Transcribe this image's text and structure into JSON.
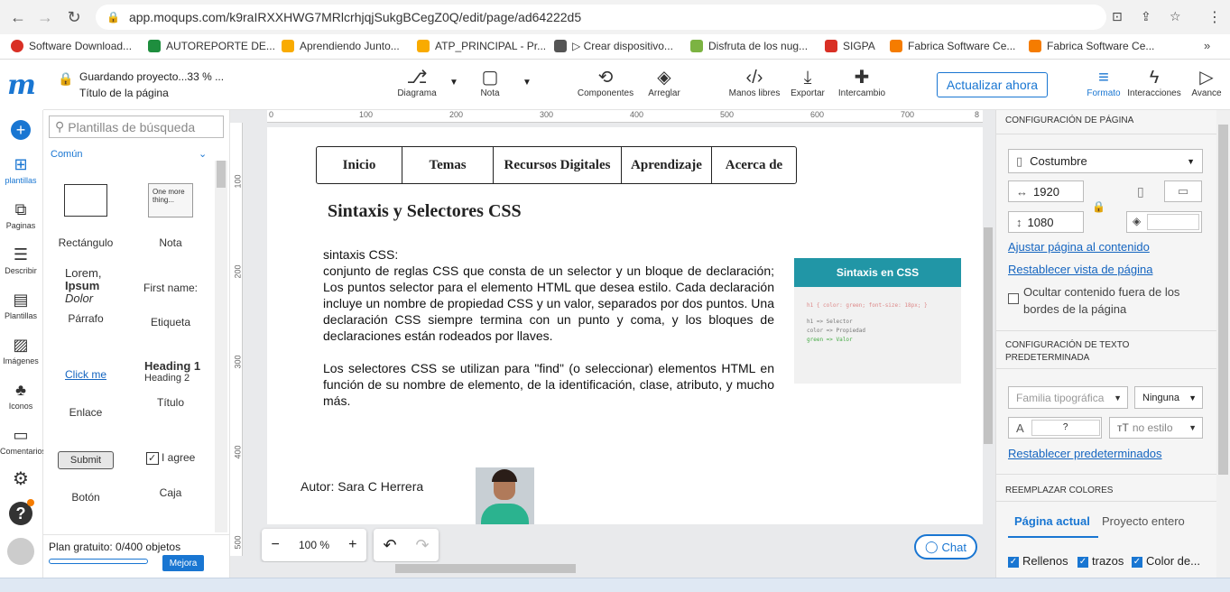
{
  "browser": {
    "url": "app.moqups.com/k9raIRXXHWG7MRlcrhjqjSukgBCegZ0Q/edit/page/ad64222d5",
    "bookmarks": [
      "Software Download...",
      "AUTOREPORTE DE...",
      "Aprendiendo Junto...",
      "ATP_PRINCIPAL - Pr...",
      "▷ Crear dispositivo...",
      "Disfruta de los nug...",
      "SIGPA",
      "Fabrica Software Ce...",
      "Fabrica Software Ce..."
    ],
    "bookmark_colors": [
      "#d93025",
      "#1e8e3e",
      "#f9ab00",
      "#f9ab00",
      "#555555",
      "#7cb342",
      "#d93025",
      "#f57c00",
      "#f57c00"
    ]
  },
  "app": {
    "logo": "m",
    "save_status": "Guardando proyecto...33 % ...",
    "page_title": "Título de la página",
    "toolbar": {
      "diagram": "Diagrama",
      "note": "Nota",
      "components": "Componentes",
      "arrange": "Arreglar",
      "freehand": "Manos libres",
      "export": "Exportar",
      "exchange": "Intercambio",
      "update_now": "Actualizar ahora",
      "format": "Formato",
      "interactions": "Interacciones",
      "advanced": "Avance"
    },
    "rail": [
      "plantillas",
      "Paginas",
      "Describir",
      "Plantillas",
      "Imágenes",
      "Iconos",
      "Comentarios"
    ],
    "accent": "#1976d2"
  },
  "templates": {
    "search_placeholder": "Plantillas de búsqueda",
    "category": "Común",
    "items": [
      {
        "label": "Rectángulo"
      },
      {
        "label": "Nota",
        "preview": "One more thing..."
      },
      {
        "label": "Párrafo",
        "preview": [
          "Lorem,",
          "Ipsum",
          "Dolor"
        ]
      },
      {
        "label": "Etiqueta",
        "preview": "First name:"
      },
      {
        "label": "Enlace",
        "preview": "Click me"
      },
      {
        "label": "Título",
        "preview": [
          "Heading 1",
          "Heading 2"
        ]
      },
      {
        "label": "Botón",
        "preview": "Submit"
      },
      {
        "label": "Caja",
        "preview": "I agree"
      }
    ],
    "plan": "Plan gratuito: 0/400 objetos",
    "upgrade": "Mejora"
  },
  "ruler": {
    "h": [
      "0",
      "100",
      "200",
      "300",
      "400",
      "500",
      "600",
      "700",
      "8"
    ],
    "v": [
      "100",
      "200",
      "300",
      "400",
      "500"
    ]
  },
  "page": {
    "nav": [
      "Inicio",
      "Temas",
      "Recursos Digitales",
      "Aprendizaje",
      "Acerca de"
    ],
    "heading": "Sintaxis y Selectores CSS",
    "paragraph1": "sintaxis CSS:\nconjunto de reglas CSS que consta de un selector y un bloque de declaración; Los puntos selector para el elemento HTML que desea estilo. Cada declaración incluye un nombre de propiedad CSS y un valor, separados por dos puntos. Una declaración CSS siempre termina con un punto y coma, y los bloques de declaraciones están rodeados por llaves.",
    "paragraph2": "Los selectores CSS se utilizan para \"find\" (o seleccionar) elementos HTML en función de su nombre de elemento, de la identificación, clase, atributo, y mucho más.",
    "image_title": "Sintaxis en CSS",
    "image_code": [
      "h1 { color: green; font-size: 18px; }",
      "h1 => Selector",
      "color => Propiedad",
      "green => Valor"
    ],
    "author": "Autor: Sara C Herrera"
  },
  "canvas_controls": {
    "zoom": "100 %",
    "minus": "−",
    "plus": "+",
    "chat": "Chat"
  },
  "format_panel": {
    "page_config": "CONFIGURACIÓN DE PÁGINA",
    "size_preset": "Costumbre",
    "width": "1920",
    "height": "1080",
    "fit": "Ajustar página al contenido",
    "reset_view": "Restablecer vista de página",
    "hide_outside": "Ocultar contenido fuera de los bordes de la página",
    "text_config": "CONFIGURACIÓN DE TEXTO PREDETERMINADA",
    "font_family_placeholder": "Familia tipográfica",
    "font_weight": "Ninguna",
    "font_size": "?",
    "text_style": "no estilo",
    "reset_defaults": "Restablecer predeterminados",
    "replace_colors": "REEMPLAZAR COLORES",
    "tab_current": "Página actual",
    "tab_project": "Proyecto entero",
    "fills": "Rellenos",
    "strokes": "trazos",
    "color_text": "Color de..."
  }
}
